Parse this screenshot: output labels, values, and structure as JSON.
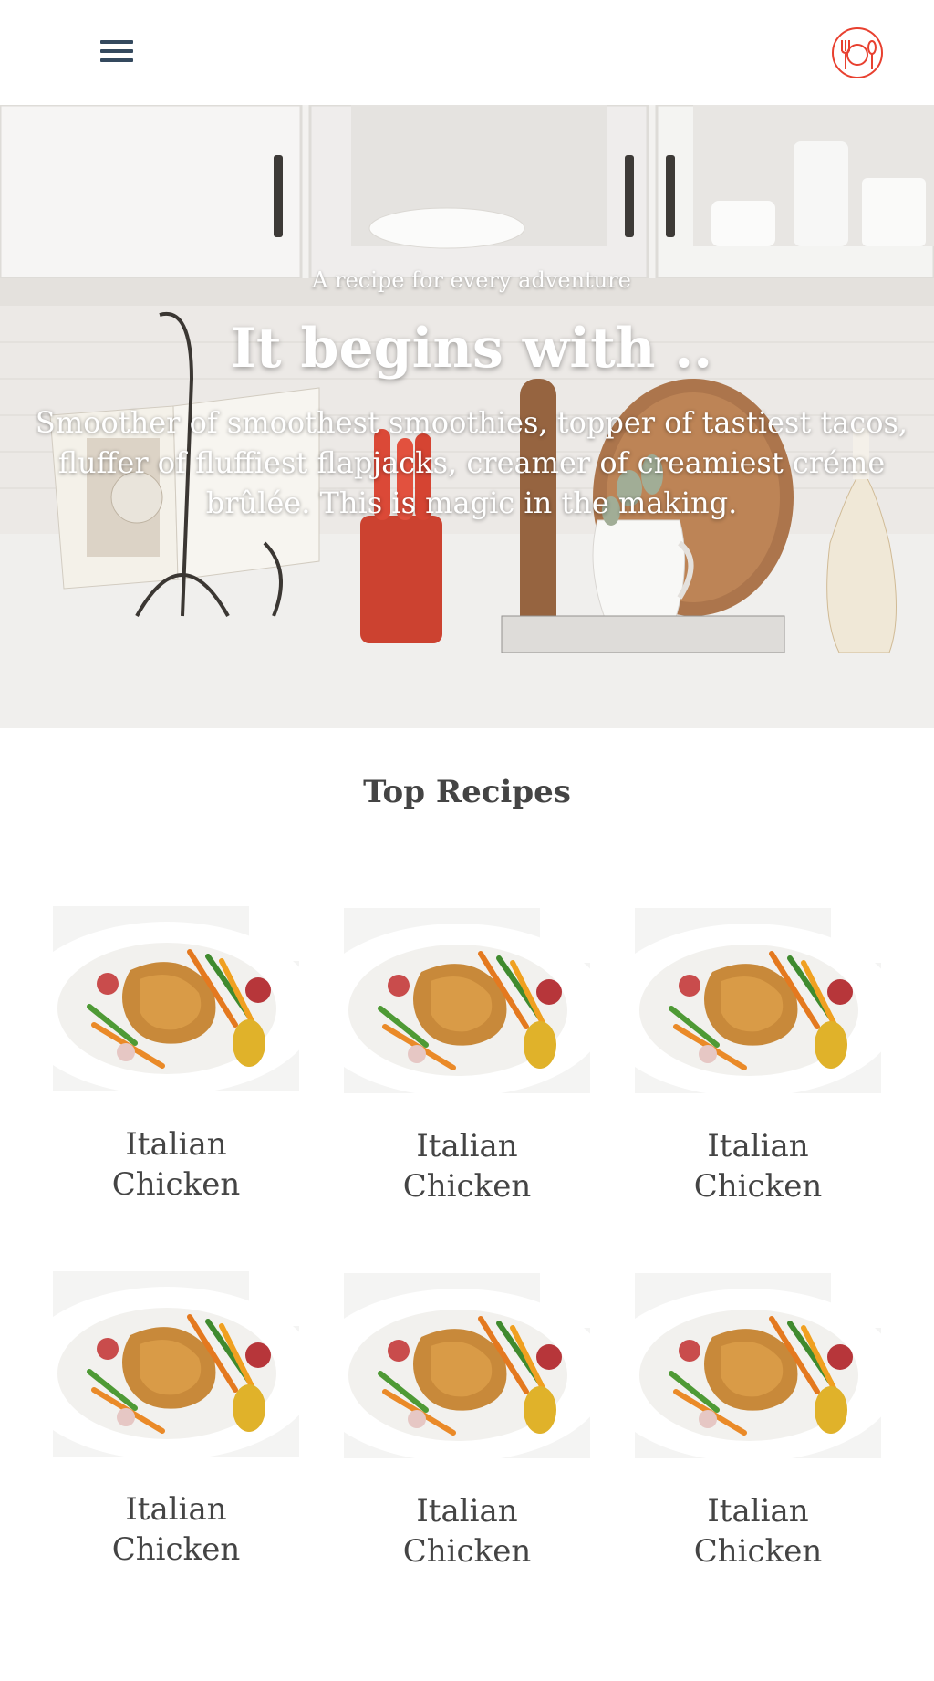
{
  "header": {
    "menu_icon": "hamburger-menu-icon",
    "logo_icon": "fork-plate-spoon-icon",
    "colors": {
      "menu": "#34495e",
      "logo": "#e8402f"
    }
  },
  "hero": {
    "kicker": "A recipe for every adventure",
    "title": "It begins with ..",
    "body": "Smoother of smoothest smoothies, topper of tastiest tacos, fluffer of fluffiest flapjacks, creamer of creamiest créme brûlée. This is magic in the making."
  },
  "section": {
    "title": "Top Recipes"
  },
  "recipes": [
    {
      "name": "Italian Chicken"
    },
    {
      "name": "Italian Chicken"
    },
    {
      "name": "Italian Chicken"
    },
    {
      "name": "Italian Chicken"
    },
    {
      "name": "Italian Chicken"
    },
    {
      "name": "Italian Chicken"
    }
  ]
}
